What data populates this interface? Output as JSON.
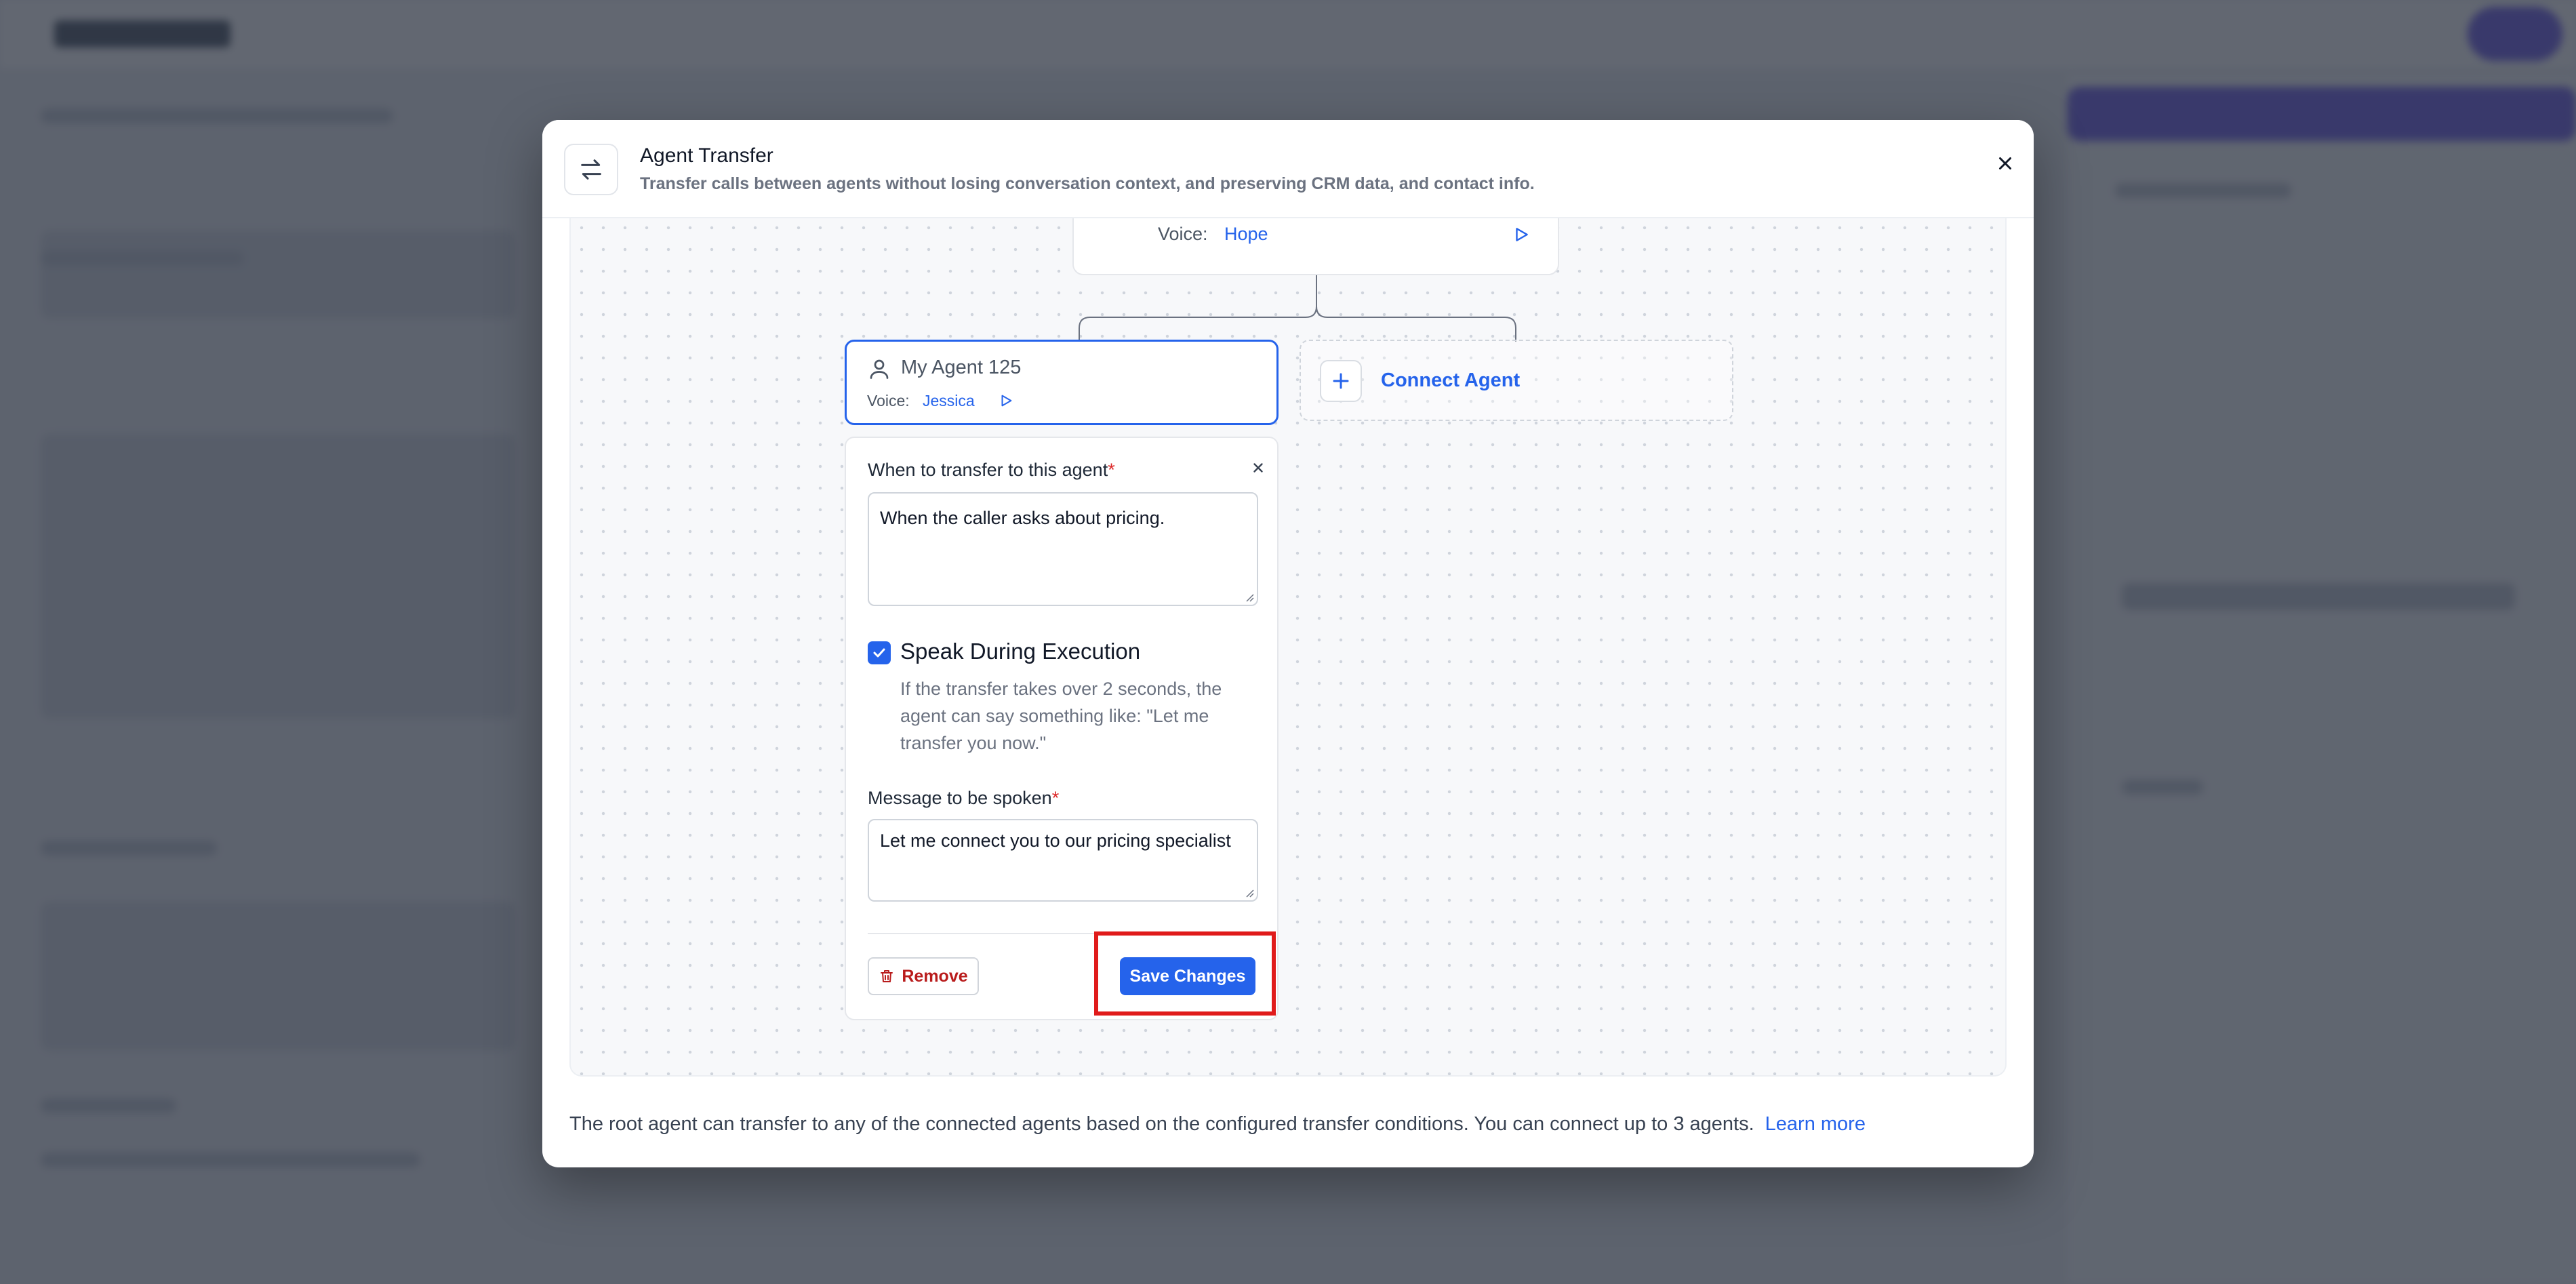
{
  "modal": {
    "title": "Agent Transfer",
    "subtitle": "Transfer calls between agents without losing conversation context, and preserving CRM data, and contact info.",
    "close_icon": "close-icon",
    "header_icon": "swap-arrows-icon"
  },
  "root_agent": {
    "voice_label": "Voice:",
    "voice_value": "Hope"
  },
  "selected_agent": {
    "name": "My Agent 125",
    "voice_label": "Voice:",
    "voice_value": "Jessica"
  },
  "connect_agent": {
    "label": "Connect Agent"
  },
  "transfer_panel": {
    "when_label": "When to transfer to this agent",
    "required_mark": "*",
    "when_value": "When the caller asks about pricing.",
    "speak_checkbox_label": "Speak During Execution",
    "speak_checked": true,
    "speak_description": "If the transfer takes over 2 seconds, the agent can say something like: \"Let me transfer you now.\"",
    "message_label": "Message to be spoken",
    "message_value": "Let me connect you to our pricing specialist",
    "remove_label": "Remove",
    "save_label": "Save Changes"
  },
  "footer": {
    "text": "The root agent can transfer to any of the connected agents based on the configured transfer conditions. You can connect up to 3 agents.",
    "link": "Learn more"
  },
  "colors": {
    "accent": "#2563eb",
    "danger": "#b91c1c",
    "highlight": "#e01b1b"
  }
}
